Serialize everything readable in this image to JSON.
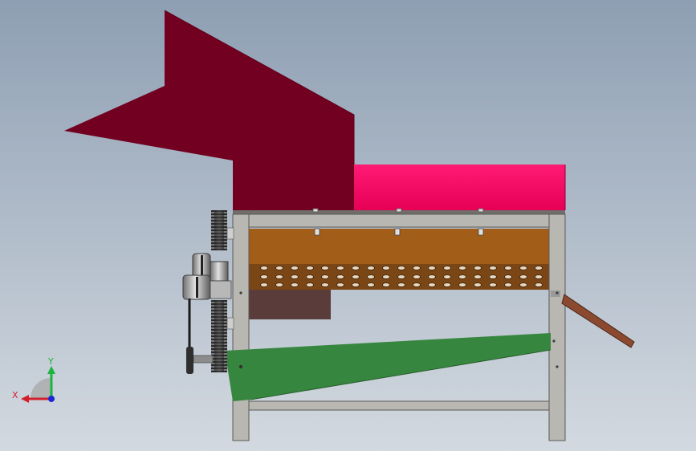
{
  "viewport": {
    "background_top": "#8e9fb3",
    "background_bottom": "#d3d9e0"
  },
  "colors": {
    "hopper": "#720020",
    "hopper_dark": "#5e001a",
    "pink_cover": "#ff0066",
    "frame": "#b9b7b1",
    "frame_edge": "#5b5a58",
    "brown_box": "#a25e18",
    "drum_dark": "#5f3710",
    "dark_brown_panel": "#5a3c3a",
    "green_tray": "#37863f",
    "chute": "#8b4a2f",
    "gear": "#2c2c2c",
    "pulley": "#8e8e8e"
  },
  "triad": {
    "x_label": "X",
    "y_label": "Y",
    "x_color": "#d21f2b",
    "y_color": "#1db33f",
    "z_color": "#1b28d2"
  }
}
